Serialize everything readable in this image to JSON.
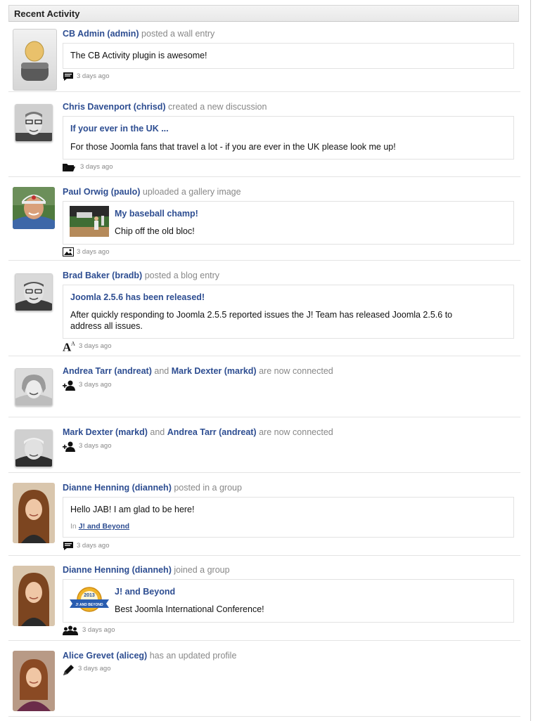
{
  "header": {
    "title": "Recent Activity"
  },
  "items": [
    {
      "actor": "CB Admin (admin)",
      "action": "posted a wall entry",
      "body": "The CB Activity plugin is awesome!",
      "time": "3 days ago",
      "icon": "comment-icon"
    },
    {
      "actor": "Chris Davenport (chrisd)",
      "action": "created a new discussion",
      "heading": "If your ever in the UK ...",
      "body": "For those Joomla fans that travel a lot - if you are ever in the UK please look me up!",
      "time": "3 days ago",
      "icon": "folder-icon"
    },
    {
      "actor": "Paul Orwig (paulo)",
      "action": "uploaded a gallery image",
      "heading": "My baseball champ!",
      "body": "Chip off the old bloc!",
      "time": "3 days ago",
      "icon": "image-icon"
    },
    {
      "actor": "Brad Baker (bradb)",
      "action": "posted a blog entry",
      "heading": "Joomla 2.5.6 has been released!",
      "body_line1": "After quickly responding to Joomla 2.5.5 reported issues the J! Team has released Joomla 2.5.6 to",
      "body_line2": "address all issues.",
      "time": "3 days ago",
      "icon": "font-icon"
    },
    {
      "actor": "Andrea Tarr (andreat)",
      "joiner": "and",
      "actor2": "Mark Dexter (markd)",
      "action": "are now connected",
      "time": "3 days ago",
      "icon": "add-user-icon"
    },
    {
      "actor": "Mark Dexter (markd)",
      "joiner": "and",
      "actor2": "Andrea Tarr (andreat)",
      "action": "are now connected",
      "time": "3 days ago",
      "icon": "add-user-icon"
    },
    {
      "actor": "Dianne Henning (dianneh)",
      "action": "posted in a group",
      "body": "Hello JAB! I am glad to be here!",
      "sub_prefix": "In",
      "sub_link": "J! and Beyond",
      "time": "3 days ago",
      "icon": "comment-icon"
    },
    {
      "actor": "Dianne Henning (dianneh)",
      "action": "joined a group",
      "heading": "J! and Beyond",
      "body": "Best Joomla International Conference!",
      "badge_year": "2013",
      "badge_text": "J! AND BEYOND",
      "time": "3 days ago",
      "icon": "group-icon"
    },
    {
      "actor": "Alice Grevet (aliceg)",
      "action": "has an updated profile",
      "time": "3 days ago",
      "icon": "pencil-icon"
    }
  ],
  "colors": {
    "link": "#2d4d91",
    "muted": "#888888",
    "border": "#e2e2e2"
  }
}
